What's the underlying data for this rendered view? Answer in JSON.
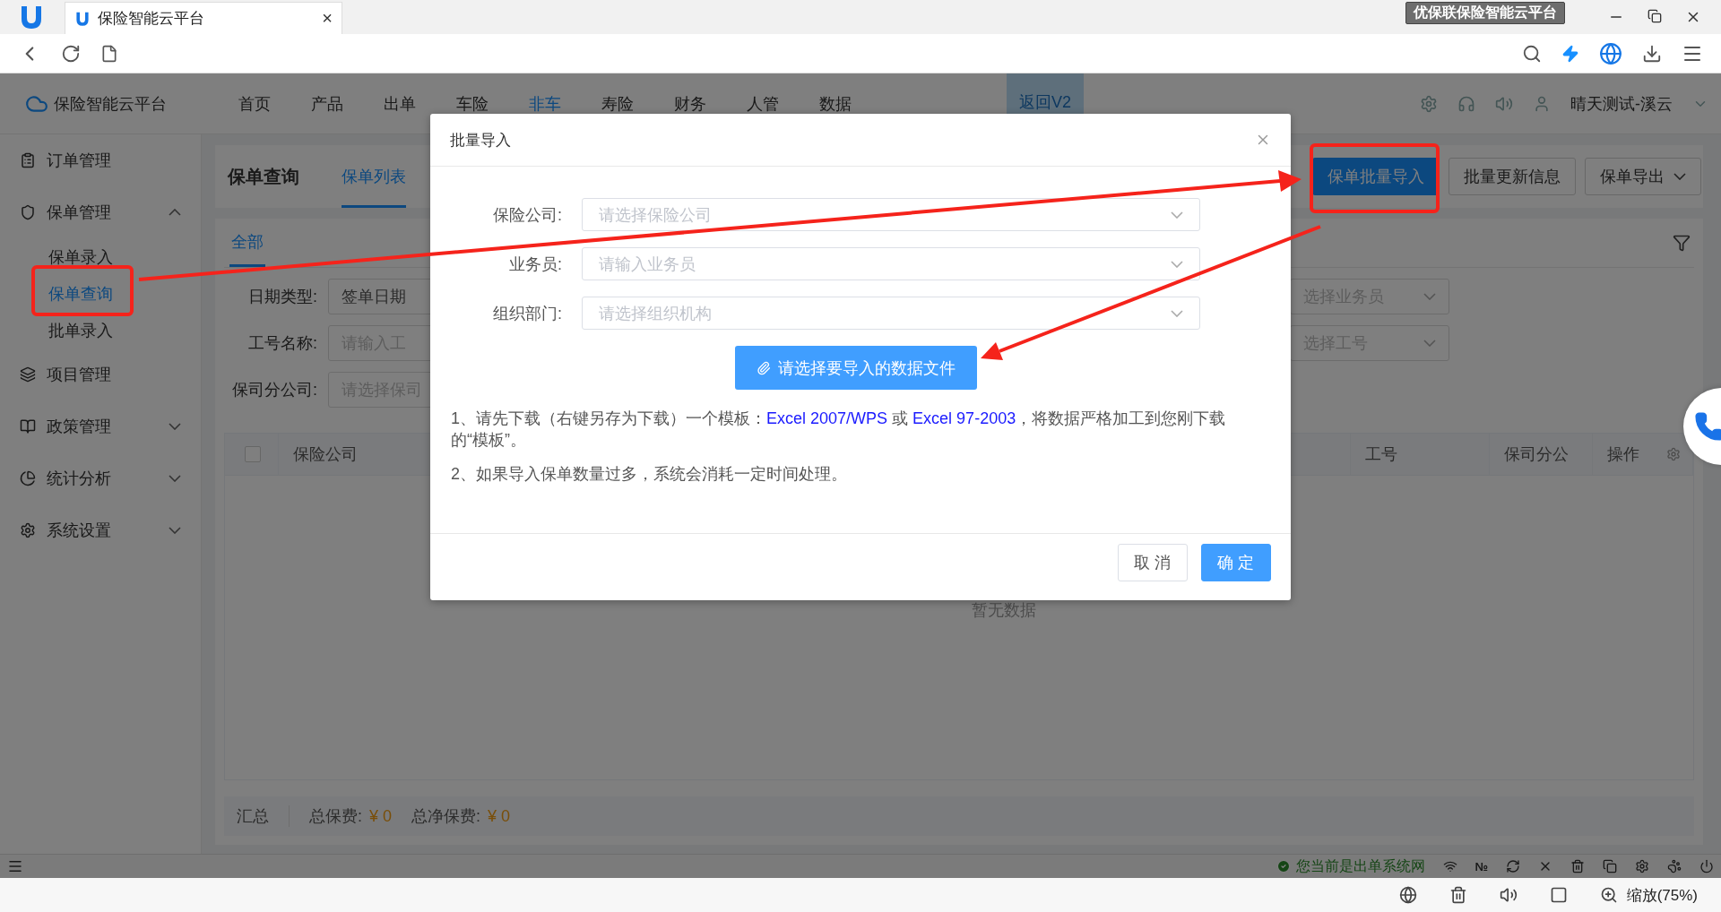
{
  "browser": {
    "tab": {
      "title": "保险智能云平台",
      "close": "×"
    },
    "badge": "优保联保险智能云平台",
    "bottom_bar": {
      "zoom": "缩放(75%)"
    }
  },
  "app": {
    "brand": "保险智能云平台",
    "nav": [
      {
        "label": "首页",
        "selected": false
      },
      {
        "label": "产品",
        "selected": false
      },
      {
        "label": "出单",
        "selected": false
      },
      {
        "label": "车险",
        "selected": false
      },
      {
        "label": "非车",
        "selected": true
      },
      {
        "label": "寿险",
        "selected": false
      },
      {
        "label": "财务",
        "selected": false
      },
      {
        "label": "人管",
        "selected": false
      },
      {
        "label": "数据",
        "selected": false
      }
    ],
    "back_button": "返回V2",
    "user": "晴天测试-溪云"
  },
  "sidebar": {
    "items": [
      {
        "label": "订单管理",
        "kind": "link"
      },
      {
        "label": "保单管理",
        "kind": "group",
        "expanded": true,
        "children": [
          {
            "label": "保单录入",
            "selected": false
          },
          {
            "label": "保单查询",
            "selected": true
          },
          {
            "label": "批单录入",
            "selected": false
          }
        ]
      },
      {
        "label": "项目管理",
        "kind": "link"
      },
      {
        "label": "政策管理",
        "kind": "group",
        "expanded": false
      },
      {
        "label": "统计分析",
        "kind": "group",
        "expanded": false
      },
      {
        "label": "系统设置",
        "kind": "group",
        "expanded": false
      }
    ]
  },
  "page": {
    "title": "保单查询",
    "tabs": [
      {
        "label": "保单列表",
        "selected": true
      }
    ],
    "actions": [
      {
        "label": "保单批量导入",
        "kind": "primary"
      },
      {
        "label": "批量更新信息",
        "kind": "default"
      },
      {
        "label": "保单导出",
        "kind": "dropdown"
      }
    ],
    "sub_tabs": [
      {
        "label": "全部",
        "selected": true
      }
    ],
    "filters_left": [
      {
        "label": "日期类型:",
        "value": "签单日期"
      },
      {
        "label": "工号名称:",
        "placeholder": "请输入工"
      },
      {
        "label": "保司分公司:",
        "placeholder": "请选择保司"
      }
    ],
    "filters_right": [
      {
        "placeholder": "选择业务员"
      },
      {
        "placeholder": "选择工号"
      }
    ],
    "table": {
      "select_all": {
        "checked": false
      },
      "columns": [
        {
          "label": "保险公司"
        },
        {
          "label": "工号"
        },
        {
          "label": "保司分公"
        },
        {
          "label": "操作"
        }
      ],
      "empty_text": "暂无数据"
    },
    "summary": {
      "label": "汇总",
      "items": [
        {
          "label": "总保费:",
          "value": "¥ 0"
        },
        {
          "label": "总净保费:",
          "value": "¥ 0"
        }
      ]
    }
  },
  "modal": {
    "title": "批量导入",
    "fields": [
      {
        "label": "保险公司:",
        "placeholder": "请选择保险公司"
      },
      {
        "label": "业务员:",
        "placeholder": "请输入业务员"
      },
      {
        "label": "组织部门:",
        "placeholder": "请选择组织机构"
      }
    ],
    "upload_button": "请选择要导入的数据文件",
    "notes": [
      {
        "parts": [
          {
            "kind": "text",
            "text": "1、请先下载（右键另存为下载）一个模板："
          },
          {
            "kind": "link",
            "text": "Excel 2007/WPS"
          },
          {
            "kind": "text",
            "text": " 或 "
          },
          {
            "kind": "link",
            "text": "Excel 97-2003"
          },
          {
            "kind": "text",
            "text": "，将数据严格加工到您刚下载的“模板”。"
          }
        ]
      },
      {
        "parts": [
          {
            "kind": "text",
            "text": "2、如果导入保单数量过多，系统会消耗一定时间处理。"
          }
        ]
      }
    ],
    "buttons": [
      {
        "label": "取 消",
        "kind": "default"
      },
      {
        "label": "确 定",
        "kind": "primary"
      }
    ]
  },
  "status_bar": {
    "network": "您当前是出单系统网",
    "number_sign": "№"
  }
}
